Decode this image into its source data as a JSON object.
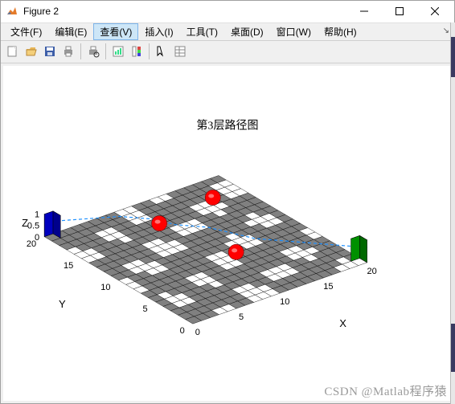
{
  "window": {
    "title": "Figure 2"
  },
  "menu": {
    "items": [
      {
        "label": "文件(F)"
      },
      {
        "label": "编辑(E)"
      },
      {
        "label": "查看(V)",
        "active": true
      },
      {
        "label": "插入(I)"
      },
      {
        "label": "工具(T)"
      },
      {
        "label": "桌面(D)"
      },
      {
        "label": "窗口(W)"
      },
      {
        "label": "帮助(H)"
      }
    ]
  },
  "toolbar": {
    "groups": [
      [
        "new-figure-icon",
        "open-icon",
        "save-icon",
        "print-icon"
      ],
      [
        "print-preview-icon"
      ],
      [
        "link-icon",
        "colorbar-icon"
      ],
      [
        "pointer-icon",
        "properties-icon"
      ]
    ]
  },
  "chart_data": {
    "type": "3d-grid",
    "title": "第3层路径图",
    "xlabel": "X",
    "ylabel": "Y",
    "zlabel": "Z",
    "x_ticks": [
      0,
      5,
      10,
      15,
      20
    ],
    "y_ticks": [
      0,
      5,
      10,
      15,
      20
    ],
    "z_ticks": [
      0,
      0.5,
      1
    ],
    "xlim": [
      0,
      20
    ],
    "ylim": [
      0,
      20
    ],
    "zlim": [
      0,
      1
    ],
    "grid_size": [
      20,
      20
    ],
    "start_cube": {
      "x": 0,
      "y": 20,
      "color": "#0000ff"
    },
    "end_cube": {
      "x": 20,
      "y": 0,
      "color": "#00c000"
    },
    "obstacle_spheres": [
      {
        "x": 8,
        "y": 14,
        "color": "#ff0000"
      },
      {
        "x": 15,
        "y": 15,
        "color": "#ff0000"
      },
      {
        "x": 10,
        "y": 6,
        "color": "#ff0000"
      }
    ],
    "path_color": "#1e90ff",
    "floor_fill": "#808080",
    "floor_wire": "#000000",
    "path_points": [
      [
        0,
        20
      ],
      [
        2,
        19
      ],
      [
        4,
        18
      ],
      [
        6,
        17
      ],
      [
        8,
        15
      ],
      [
        9,
        13
      ],
      [
        11,
        11
      ],
      [
        12,
        9
      ],
      [
        13,
        7
      ],
      [
        15,
        5
      ],
      [
        17,
        3
      ],
      [
        19,
        1
      ],
      [
        20,
        0
      ]
    ]
  },
  "watermark": "CSDN @Matlab程序猿"
}
